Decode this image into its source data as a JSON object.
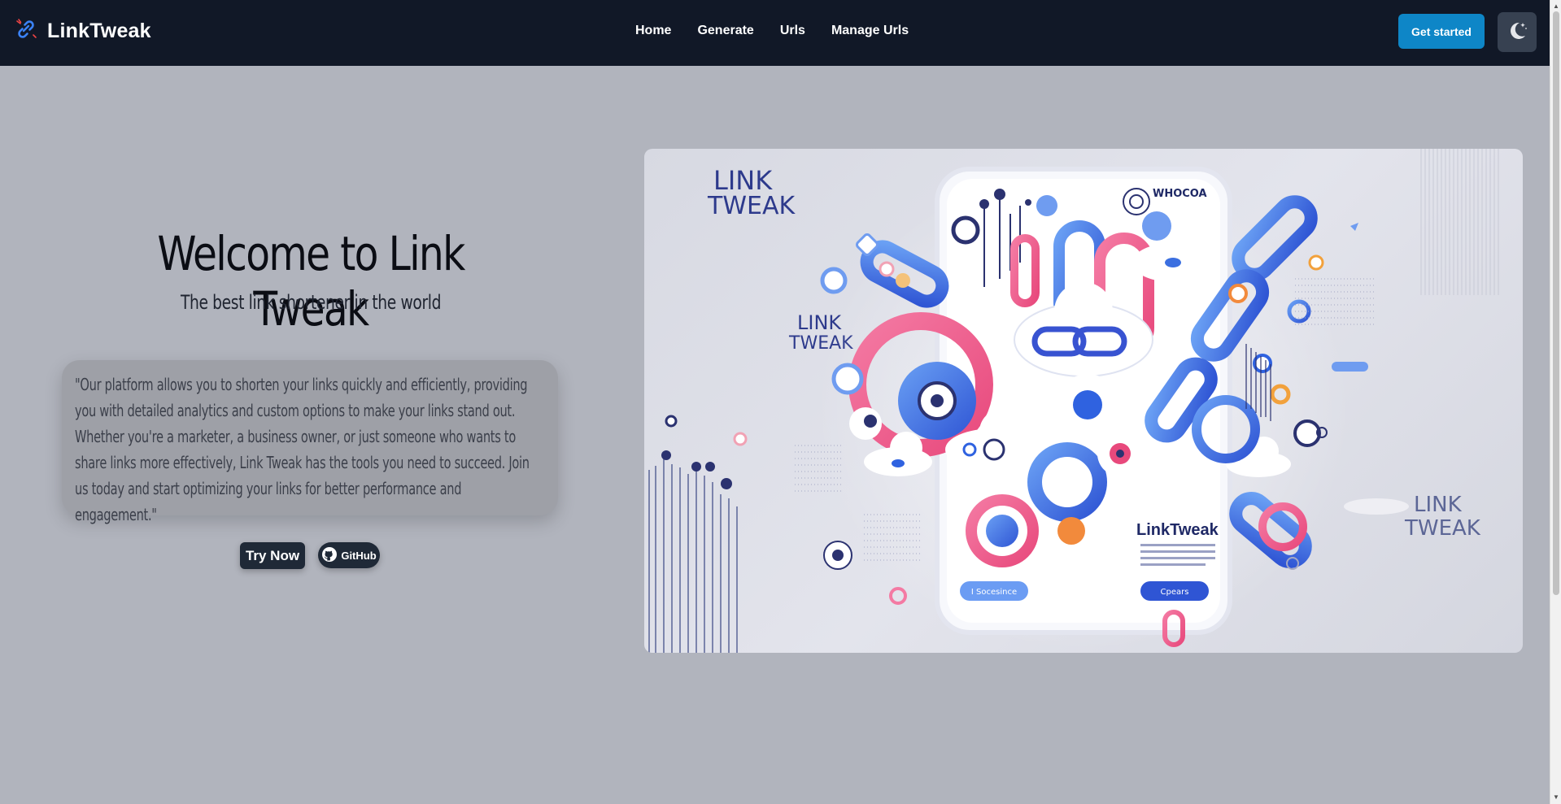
{
  "navbar": {
    "brand": "LinkTweak",
    "links": [
      {
        "label": "Home"
      },
      {
        "label": "Generate"
      },
      {
        "label": "Urls"
      },
      {
        "label": "Manage Urls"
      }
    ],
    "cta_label": "Get started",
    "theme_icon": "moon-stars-icon",
    "logo_icon": "link-icon"
  },
  "hero": {
    "title": "Welcome to Link Tweak",
    "subtitle": "The best link shortener in the world",
    "description": "\"Our platform allows you to shorten your links quickly and efficiently, providing you with detailed analytics and custom options to make your links stand out. Whether you're a marketer, a business owner, or just someone who wants to share links more effectively, Link Tweak has the tools you need to succeed. Join us today and start optimizing your links for better performance and engagement.\"",
    "try_label": "Try Now",
    "github_label": "GitHub"
  },
  "illustration": {
    "label_top_left": "LINK",
    "label_top_left_2": "TWEAK",
    "label_mid_left": "LINK",
    "label_mid_left_2": "TWEAK",
    "label_right": "LINK",
    "label_right_2": "TWEAK",
    "phone_header": "WHOCOA",
    "phone_brand": "LinkTweak",
    "phone_button_left": "I Socesince",
    "phone_button_right": "Cpears"
  },
  "colors": {
    "navbar_bg": "#111827",
    "page_bg": "#b1b4bd",
    "accent": "#0e86c7",
    "button_dark": "#1f2937"
  }
}
